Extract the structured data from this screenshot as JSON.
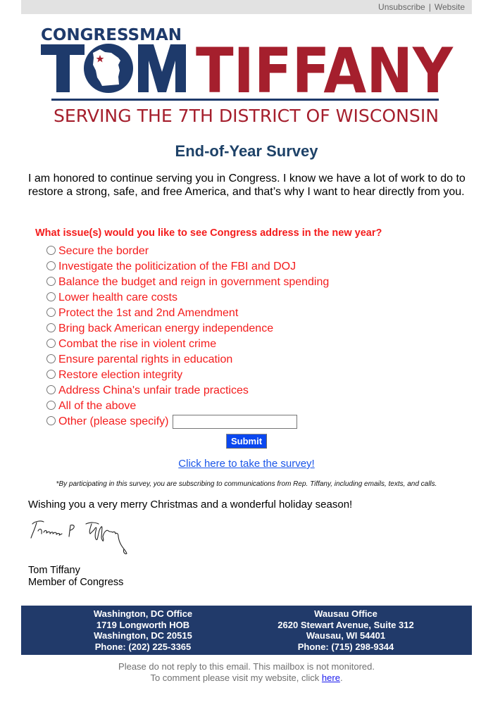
{
  "topbar": {
    "unsubscribe_label": "Unsubscribe",
    "separator": "|",
    "website_label": "Website"
  },
  "logo": {
    "line1": "CONGRESSMAN",
    "first_name": "TOM",
    "last_name": "TIFFANY",
    "tagline": "SERVING THE 7TH DISTRICT OF WISCONSIN",
    "colors": {
      "navy": "#1e3a6b",
      "red": "#a51f2d"
    }
  },
  "title": "End-of-Year Survey",
  "intro": "I am honored to continue serving you in Congress. I know we have a lot of work to do to restore a strong, safe, and free America, and that’s why I want to hear directly from you.",
  "survey": {
    "question": "What issue(s) would you like to see Congress address in the new year?",
    "options": [
      "Secure the border",
      "Investigate the politicization of the FBI and DOJ",
      "Balance the budget and reign in government spending",
      "Lower health care costs",
      "Protect the 1st and 2nd Amendment",
      "Bring back American energy independence",
      "Combat the rise in violent crime",
      "Ensure parental rights in education",
      "Restore election integrity",
      "Address China's unfair trade practices",
      "All of the above",
      "Other (please specify)"
    ],
    "other_value": "",
    "submit_label": "Submit",
    "accent_color": "#f41c1c"
  },
  "survey_link": "Click here to take the survey!",
  "disclaimer": "*By participating in this survey, you are subscribing to communications from Rep. Tiffany, including emails, texts, and calls.",
  "wish": "Wishing you a very merry Christmas and a wonderful holiday season!",
  "signoff": {
    "name": "Tom Tiffany",
    "role": "Member of Congress"
  },
  "footer": {
    "offices": [
      {
        "name": "Washington, DC Office",
        "line1": "1719 Longworth HOB",
        "line2": "Washington, DC 20515",
        "phone": "Phone: (202) 225-3365"
      },
      {
        "name": "Wausau Office",
        "line1": "2620 Stewart Avenue, Suite 312",
        "line2": "Wausau, WI  54401",
        "phone": "Phone: (715) 298-9344"
      }
    ],
    "background": "#213a6a"
  },
  "noreply": {
    "line1": "Please do not reply to this email. This mailbox is not monitored.",
    "line2_prefix": "To comment please visit my website, click ",
    "link_label": "here",
    "line2_suffix": "."
  }
}
